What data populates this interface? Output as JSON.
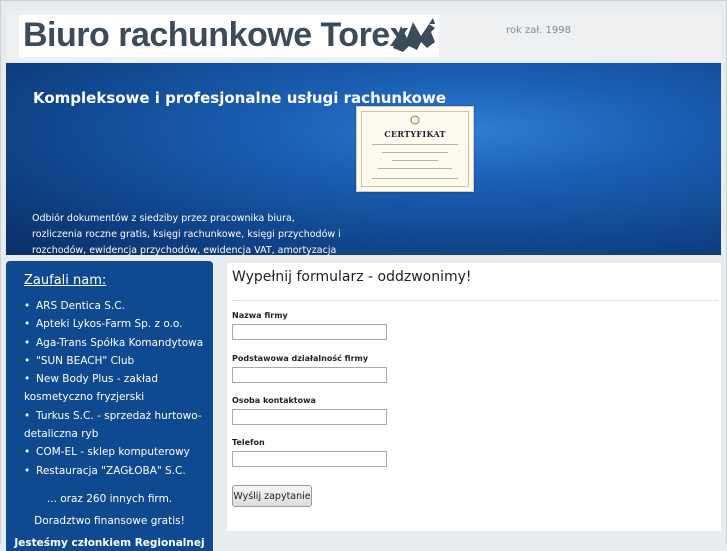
{
  "header": {
    "logo_text": "Biuro rachunkowe Torex",
    "founded": "rok zał. 1998"
  },
  "hero": {
    "title": "Kompleksowe i profesjonalne usługi rachunkowe",
    "certificate_title": "CERTYFIKAT",
    "text": "Odbiór dokumentów z siedziby przez pracownika biura, rozliczenia roczne gratis, księgi rachunkowe, księgi przychodów i rozchodów, ewidencja przychodów, ewidencja VAT, amortyzacja środków trwałych, deklaracje"
  },
  "sidebar": {
    "title": "Zaufali nam:",
    "clients": [
      "ARS Dentica S.C.",
      "Apteki Lykos-Farm Sp. z o.o.",
      "Aga-Trans Spółka Komandytowa",
      "\"SUN BEACH\" Club",
      "New Body Plus - zakład kosmetyczno fryzjerski",
      "Turkus S.C. - sprzedaż hurtowo-detaliczna ryb",
      "COM-EL - sklep komputerowy",
      "Restauracja \"ZAGŁOBA\" S.C."
    ],
    "more": "... oraz 260 innych firm.",
    "advice": "Doradztwo finansowe gratis!",
    "member": "Jesteśmy członkiem Regionalnej"
  },
  "form": {
    "title": "Wypełnij formularz - oddzwonimy!",
    "fields": [
      {
        "label": "Nazwa firmy",
        "value": ""
      },
      {
        "label": "Podstawowa działalność firmy",
        "value": ""
      },
      {
        "label": "Osoba kontaktowa",
        "value": ""
      },
      {
        "label": "Telefon",
        "value": ""
      }
    ],
    "submit_label": "Wyślij zapytanie"
  },
  "colors": {
    "sidebar_bg": "#0f4a90",
    "hero_bg": "#1a5fb4",
    "page_bg": "#e9ecef"
  }
}
